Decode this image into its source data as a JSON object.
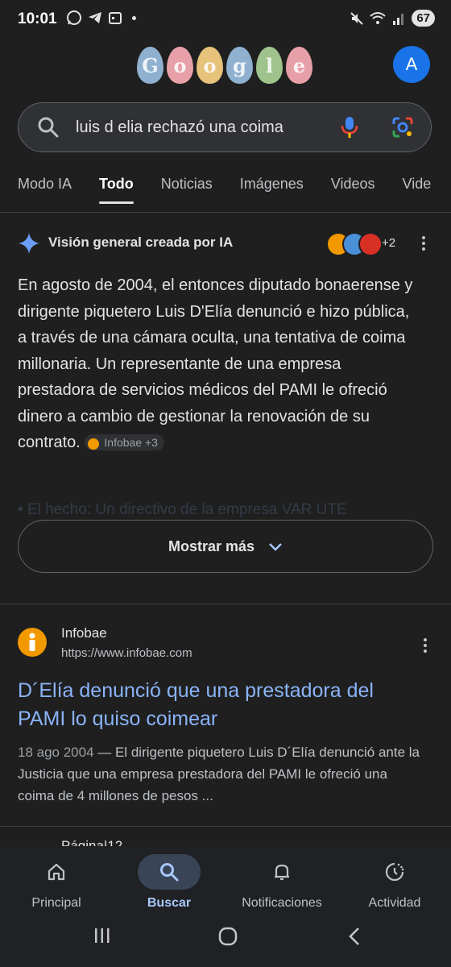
{
  "status_bar": {
    "time": "10:01",
    "battery": "67"
  },
  "header": {
    "logo_letters": [
      "G",
      "o",
      "o",
      "g",
      "l",
      "e"
    ],
    "avatar_letter": "A"
  },
  "search": {
    "query": "luis d elia rechazó una coima"
  },
  "tabs": [
    "Modo IA",
    "Todo",
    "Noticias",
    "Imágenes",
    "Videos",
    "Vide"
  ],
  "ai_overview": {
    "title": "Visión general creada por IA",
    "sources_more": "+2",
    "body": "En agosto de 2004, el entonces diputado bonaerense y dirigente piquetero Luis D'Elía denunció e hizo pública, a través de una cámara oculta, una tentativa de coima millonaria. Un representante de una empresa prestadora de servicios médicos del PAMI le ofreció dinero a cambio de gestionar la renovación de su contrato.",
    "citation": "Infobae +3",
    "faded_line": "El hecho: Un directivo de la empresa VAR UTE",
    "show_more": "Mostrar más"
  },
  "result": {
    "site_name": "Infobae",
    "site_url": "https://www.infobae.com",
    "title": "D´Elía denunció que una prestadora del PAMI lo quiso coimear",
    "date": "18 ago 2004",
    "snippet": " — El dirigente piquetero Luis D´Elía denunció ante la Justicia que una empresa prestadora del PAMI le ofreció una coima de 4 millones de pesos ...",
    "next_site_partial": "Página|12"
  },
  "bottom_nav": [
    {
      "label": "Principal",
      "icon": "home-icon"
    },
    {
      "label": "Buscar",
      "icon": "search-icon"
    },
    {
      "label": "Notificaciones",
      "icon": "bell-icon"
    },
    {
      "label": "Actividad",
      "icon": "activity-icon"
    }
  ],
  "colors": {
    "background": "#1f1f1f",
    "link": "#8ab4f8",
    "accent": "#1a73e8",
    "active_nav": "#a8c7fa"
  }
}
